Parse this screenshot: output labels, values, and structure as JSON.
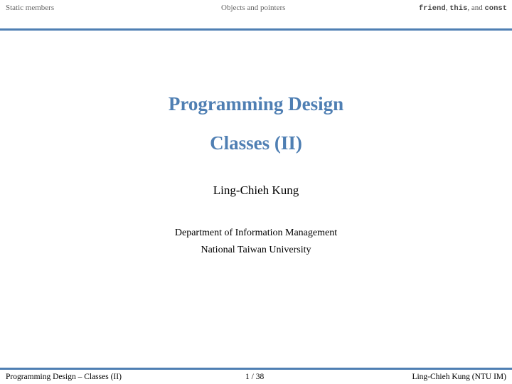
{
  "header": {
    "nav_left": "Static members",
    "nav_center": "Objects and pointers",
    "nav_right_code1": "friend",
    "nav_right_code2": "this",
    "nav_right_and": ", and ",
    "nav_right_code3": "const"
  },
  "slide": {
    "title": "Programming Design",
    "subtitle": "Classes (II)",
    "author": "Ling-Chieh Kung",
    "institute_line1": "Department of Information Management",
    "institute_line2": "National Taiwan University"
  },
  "footer": {
    "left": "Programming Design – Classes (II)",
    "center": "1 / 38",
    "right": "Ling-Chieh Kung (NTU IM)"
  },
  "colors": {
    "accent": "#4f7fb3",
    "nav_text": "#666666"
  }
}
